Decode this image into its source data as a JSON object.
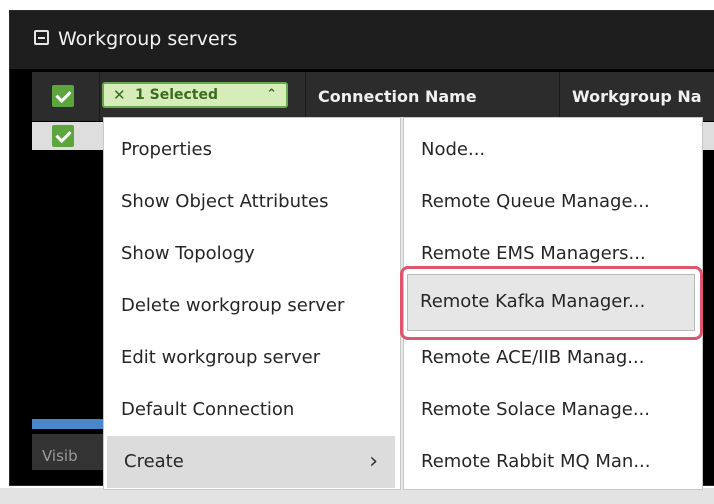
{
  "panel": {
    "title": "Workgroup servers"
  },
  "grid": {
    "selection_count": "1 Selected",
    "columns": [
      "Connection Name",
      "Workgroup Na"
    ]
  },
  "footer": {
    "text": "Visib"
  },
  "context_menu": {
    "items": [
      "Properties",
      "Show Object Attributes",
      "Show Topology",
      "Delete workgroup server",
      "Edit workgroup server",
      "Default Connection",
      "Create"
    ],
    "highlighted": "Create"
  },
  "submenu": {
    "items": [
      "Node...",
      "Remote Queue Manage...",
      "Remote EMS Managers...",
      "Remote Kafka Manager...",
      "Remote ACE/IIB Manag...",
      "Remote Solace Manage...",
      "Remote Rabbit MQ Man..."
    ],
    "highlighted": "Remote Kafka Manager..."
  },
  "colors": {
    "accent_green": "#5da63d",
    "highlight_ring": "#e0546e",
    "scroll_blue": "#4a87c9"
  },
  "icons": [
    "collapse-icon",
    "close-icon",
    "chevron-up-icon",
    "chevron-right-icon",
    "checkbox-checked-icon"
  ]
}
